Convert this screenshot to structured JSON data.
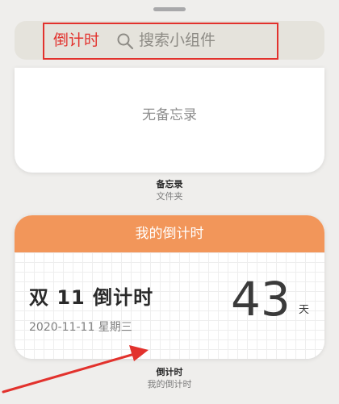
{
  "search": {
    "prefix": "倒计时",
    "placeholder": "搜索小组件"
  },
  "notes_widget": {
    "empty_text": "无备忘录",
    "title": "备忘录",
    "subtitle": "文件夹"
  },
  "countdown_widget": {
    "header": "我的倒计时",
    "event_name": "双 11 倒计时",
    "date": "2020-11-11 星期三",
    "days_left": "43",
    "unit": "天",
    "title": "倒计时",
    "subtitle": "我的倒计时"
  },
  "colors": {
    "highlight_red": "#e2322d",
    "header_orange": "#f2965a"
  },
  "icons": [
    "search-icon",
    "arrow-annotation"
  ]
}
